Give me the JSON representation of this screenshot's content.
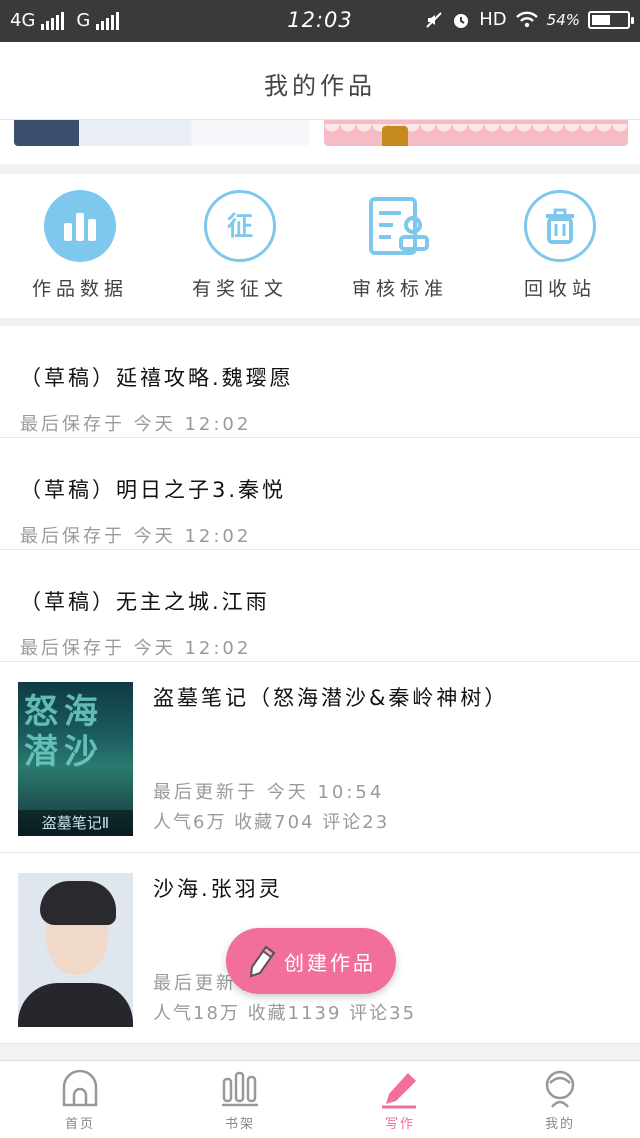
{
  "status_bar": {
    "network1": "4G",
    "network2": "G",
    "time": "12:03",
    "hd": "HD",
    "battery": "54%",
    "battery_level": 0.54
  },
  "header": {
    "title": "我的作品"
  },
  "actions": [
    {
      "label": "作品数据",
      "icon": "bar-chart-icon"
    },
    {
      "label": "有奖征文",
      "icon": "contest-icon"
    },
    {
      "label": "审核标准",
      "icon": "review-standard-icon"
    },
    {
      "label": "回收站",
      "icon": "trash-icon"
    }
  ],
  "drafts": [
    {
      "title": "（草稿）延禧攻略.魏璎愿",
      "meta": "最后保存于 今天 12:02"
    },
    {
      "title": "（草稿）明日之子3.秦悦",
      "meta": "最后保存于 今天 12:02"
    },
    {
      "title": "（草稿）无主之城.江雨",
      "meta": "最后保存于 今天 12:02"
    }
  ],
  "books": [
    {
      "title": "盗墓笔记（怒海潜沙&秦岭神树）",
      "cover_text": "怒海潜沙",
      "cover_sub": "盗墓笔记Ⅱ",
      "updated": "最后更新于 今天 10:54",
      "stats": "人气6万 收藏704 评论23"
    },
    {
      "title": "沙海.张羽灵",
      "updated": "最后更新于 今天 11:21",
      "stats": "人气18万 收藏1139 评论35"
    }
  ],
  "fab": {
    "label": "创建作品"
  },
  "tabs": [
    {
      "label": "首页",
      "icon": "home-icon"
    },
    {
      "label": "书架",
      "icon": "bookshelf-icon"
    },
    {
      "label": "写作",
      "icon": "pencil-icon"
    },
    {
      "label": "我的",
      "icon": "profile-icon"
    }
  ],
  "colors": {
    "accent": "#f16f99",
    "icon_blue": "#7ec8ee"
  }
}
